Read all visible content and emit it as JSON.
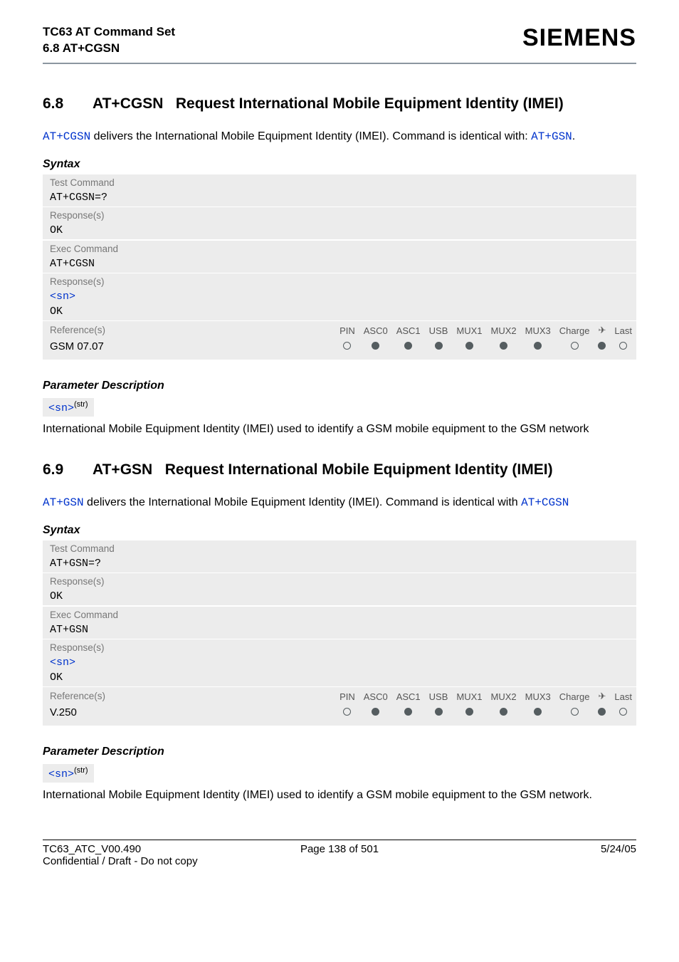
{
  "header": {
    "line1": "TC63 AT Command Set",
    "line2": "6.8 AT+CGSN",
    "brand": "SIEMENS"
  },
  "sections": [
    {
      "num": "6.8",
      "cmd": "AT+CGSN",
      "title_rest": "Request International Mobile Equipment Identity (IMEI)",
      "intro_pre": "AT+CGSN",
      "intro_mid": " delivers the International Mobile Equipment Identity (IMEI). Command is identical with: ",
      "intro_link2": "AT+GSN",
      "intro_post": ".",
      "syntax_label": "Syntax",
      "test_label": "Test Command",
      "test_cmd": "AT+CGSN=?",
      "resp_label": "Response(s)",
      "test_resp": "OK",
      "exec_label": "Exec Command",
      "exec_cmd": "AT+CGSN",
      "exec_resp1": "<sn>",
      "exec_resp2": "OK",
      "ref_label": "Reference(s)",
      "ref_val": "GSM 07.07",
      "flags_hdr": [
        "PIN",
        "ASC0",
        "ASC1",
        "USB",
        "MUX1",
        "MUX2",
        "MUX3",
        "Charge",
        "✈",
        "Last"
      ],
      "flags_val": [
        "o",
        "f",
        "f",
        "f",
        "f",
        "f",
        "f",
        "o",
        "f",
        "o"
      ],
      "param_h": "Parameter Description",
      "param_tag": "<sn>",
      "param_sup": "(str)",
      "param_desc": "International Mobile Equipment Identity (IMEI) used to identify a GSM mobile equipment to the GSM network"
    },
    {
      "num": "6.9",
      "cmd": "AT+GSN",
      "title_rest": "Request International Mobile Equipment Identity (IMEI)",
      "intro_pre": "AT+GSN",
      "intro_mid": " delivers the International Mobile Equipment Identity (IMEI). Command is identical with ",
      "intro_link2": "AT+CGSN",
      "intro_post": "",
      "syntax_label": "Syntax",
      "test_label": "Test Command",
      "test_cmd": "AT+GSN=?",
      "resp_label": "Response(s)",
      "test_resp": "OK",
      "exec_label": "Exec Command",
      "exec_cmd": "AT+GSN",
      "exec_resp1": "<sn>",
      "exec_resp2": "OK",
      "ref_label": "Reference(s)",
      "ref_val": "V.250",
      "flags_hdr": [
        "PIN",
        "ASC0",
        "ASC1",
        "USB",
        "MUX1",
        "MUX2",
        "MUX3",
        "Charge",
        "✈",
        "Last"
      ],
      "flags_val": [
        "o",
        "f",
        "f",
        "f",
        "f",
        "f",
        "f",
        "o",
        "f",
        "o"
      ],
      "param_h": "Parameter Description",
      "param_tag": "<sn>",
      "param_sup": "(str)",
      "param_desc": "International Mobile Equipment Identity (IMEI) used to identify a GSM mobile equipment to the GSM network."
    }
  ],
  "footer": {
    "left": "TC63_ATC_V00.490",
    "center": "Page 138 of 501",
    "right": "5/24/05",
    "confidential": "Confidential / Draft - Do not copy"
  }
}
